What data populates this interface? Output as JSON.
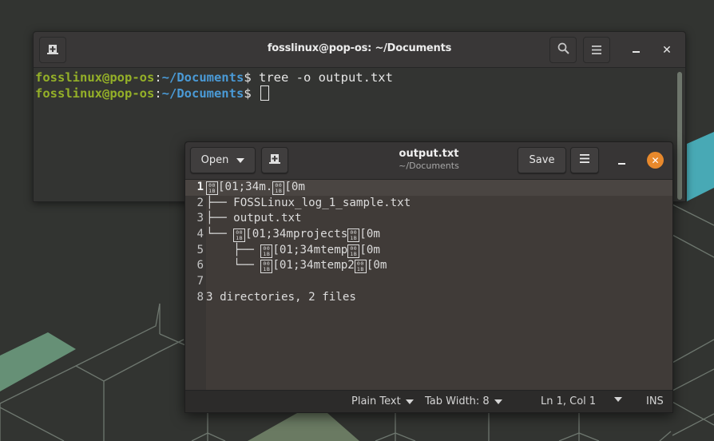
{
  "terminal": {
    "title": "fosslinux@pop-os: ~/Documents",
    "new_tab_icon": "new-tab-icon",
    "search_icon": "search-icon",
    "menu_icon": "hamburger-menu-icon",
    "minimize_label": "_",
    "close_label": "✕",
    "lines": [
      {
        "user": "fosslinux@pop-os",
        "sep": ":",
        "path": "~/Documents",
        "prompt": "$ ",
        "command": "tree -o output.txt"
      },
      {
        "user": "fosslinux@pop-os",
        "sep": ":",
        "path": "~/Documents",
        "prompt": "$ ",
        "command": ""
      }
    ]
  },
  "editor": {
    "open_label": "Open",
    "new_doc_icon": "new-document-icon",
    "title": "output.txt",
    "subtitle": "~/Documents",
    "save_label": "Save",
    "minimize_label": "_",
    "close_label": "✕",
    "current_line": 1,
    "lines": [
      {
        "num": "1",
        "pre": "",
        "segments": [
          [
            "esc",
            "001B"
          ],
          [
            "t",
            "[01;34m."
          ],
          [
            "esc",
            "001B"
          ],
          [
            "t",
            "[0m"
          ]
        ]
      },
      {
        "num": "2",
        "pre": "├── ",
        "segments": [
          [
            "t",
            "FOSSLinux_log_1_sample.txt"
          ]
        ]
      },
      {
        "num": "3",
        "pre": "├── ",
        "segments": [
          [
            "t",
            "output.txt"
          ]
        ]
      },
      {
        "num": "4",
        "pre": "└── ",
        "segments": [
          [
            "esc",
            "001B"
          ],
          [
            "t",
            "[01;34mprojects"
          ],
          [
            "esc",
            "001B"
          ],
          [
            "t",
            "[0m"
          ]
        ]
      },
      {
        "num": "5",
        "pre": "    ├── ",
        "segments": [
          [
            "esc",
            "001B"
          ],
          [
            "t",
            "[01;34mtemp"
          ],
          [
            "esc",
            "001B"
          ],
          [
            "t",
            "[0m"
          ]
        ]
      },
      {
        "num": "6",
        "pre": "    └── ",
        "segments": [
          [
            "esc",
            "001B"
          ],
          [
            "t",
            "[01;34mtemp2"
          ],
          [
            "esc",
            "001B"
          ],
          [
            "t",
            "[0m"
          ]
        ]
      },
      {
        "num": "7",
        "pre": "",
        "segments": []
      },
      {
        "num": "8",
        "pre": "",
        "segments": [
          [
            "t",
            "3 directories, 2 files"
          ]
        ]
      }
    ],
    "status": {
      "language": "Plain Text",
      "tab_width": "Tab Width: 8",
      "position": "Ln 1, Col 1",
      "mode": "INS"
    }
  },
  "colors": {
    "prompt_user": "#94b028",
    "prompt_path": "#4a9ad6",
    "close_button": "#e8892c",
    "accent_teal": "#48a9b5",
    "accent_green": "#6c9a7e"
  }
}
